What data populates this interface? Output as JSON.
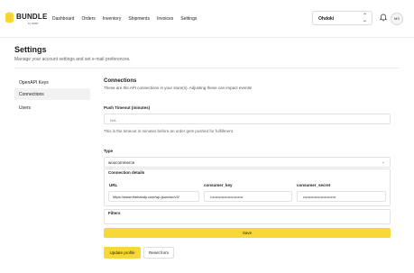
{
  "brand": {
    "name": "BUNDLE",
    "sub": "by GRIP"
  },
  "nav": {
    "items": [
      "Dashboard",
      "Orders",
      "Inventory",
      "Shipments",
      "Invoices",
      "Settings"
    ]
  },
  "store_select": {
    "value": "Ohdoki"
  },
  "avatar": {
    "initials": "MS"
  },
  "page": {
    "title": "Settings",
    "subtitle": "Manage your account settings and set e-mail preferences."
  },
  "sidebar": {
    "items": [
      {
        "label": "OpenAPI Keys"
      },
      {
        "label": "Connections",
        "active": true
      },
      {
        "label": "Users"
      }
    ]
  },
  "connections": {
    "title": "Connections",
    "subtitle": "These are the API connections in your store(s). Adjusting these can impact events!",
    "push_timeout": {
      "label": "Push Timeout (minutes)",
      "placeholder": "N/A",
      "helper": "This is the timeout in minutes before an order gets pushed for fulfillment."
    },
    "type": {
      "label": "Type",
      "value": "woocommerce"
    },
    "connection_details": {
      "label": "Connection details",
      "url_label": "URL",
      "url_value": "https://www.thehandy.com/wp-json/wc/v3/",
      "key_label": "consumer_key",
      "key_value": "••••••••••••••••••••••••••",
      "secret_label": "consumer_secret",
      "secret_value": "••••••••••••••••••••••••••"
    },
    "filters": {
      "label": "Filters"
    },
    "save_label": "Save"
  },
  "actions": {
    "update_label": "Update profile",
    "reset_label": "Reset form"
  },
  "colors": {
    "accent": "#f7d838",
    "border": "#e3e3e3",
    "active_bg": "#f2f2f2"
  }
}
